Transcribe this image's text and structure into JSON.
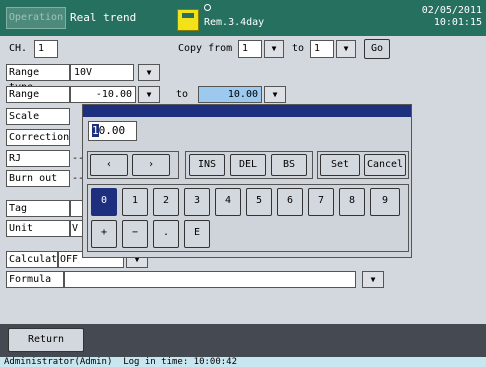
{
  "header": {
    "operation_label": "Operation",
    "title": "Real trend",
    "rem_text": "Rem.3.4day",
    "date": "02/05/2011",
    "time": "10:01:15",
    "storage_icon": "memory-card-icon"
  },
  "top": {
    "ch_label": "CH.",
    "ch_value": "1",
    "copy_from_label": "Copy from",
    "copy_from_value": "1",
    "to_label": "to",
    "to_value": "1",
    "go_label": "Go"
  },
  "form": {
    "range_type_label": "Range type",
    "range_type_value": "10V",
    "range_label": "Range",
    "range_min": "-10.00",
    "range_to_label": "to",
    "range_max": "10.00",
    "scale_label": "Scale",
    "correction_label": "Correction",
    "rj_label": "RJ",
    "rj_value": "--",
    "burnout_label": "Burn out",
    "burnout_value": "--",
    "tag_label": "Tag",
    "unit_label": "Unit",
    "unit_value": "V",
    "calculate_label": "Calculate",
    "calculate_value": "OFF",
    "formula_label": "Formula",
    "formula_value": ""
  },
  "dialog": {
    "input_first": "1",
    "input_rest": "0.00",
    "left_arrow": "‹",
    "right_arrow": "›",
    "ins": "INS",
    "del": "DEL",
    "bs": "BS",
    "set": "Set",
    "cancel": "Cancel",
    "digits": [
      "0",
      "1",
      "2",
      "3",
      "4",
      "5",
      "6",
      "7",
      "8",
      "9"
    ],
    "ops": [
      "+",
      "−",
      ".",
      "E"
    ]
  },
  "bottom": {
    "return_label": "Return"
  },
  "status": {
    "user": "Administrator(Admin)",
    "login": "Log in time: 10:00:42"
  },
  "colors": {
    "header": "#26705f",
    "dialog_bar": "#1f2f80",
    "selected_field": "#9dc9ee",
    "status_bar": "#c7e6f0",
    "bottom_bar": "#454a52"
  }
}
